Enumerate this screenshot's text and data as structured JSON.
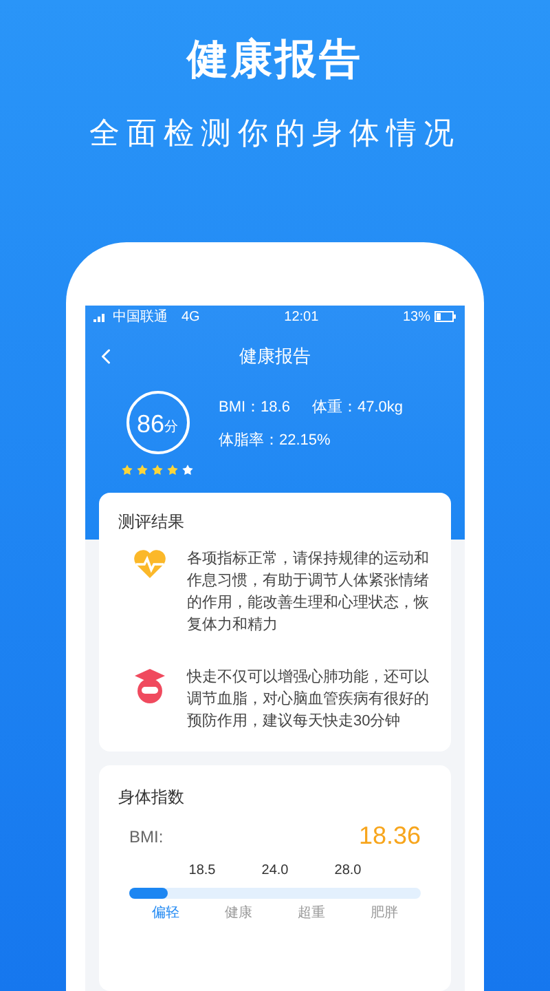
{
  "promo": {
    "title": "健康报告",
    "subtitle": "全面检测你的身体情况"
  },
  "status_bar": {
    "carrier": "中国联通",
    "network": "4G",
    "time": "12:01",
    "battery": "13%"
  },
  "nav": {
    "title": "健康报告"
  },
  "summary": {
    "score": "86",
    "unit": "分",
    "stars": 4,
    "bmi": "BMI：18.6",
    "weight": "体重：47.0kg",
    "body_fat": "体脂率：22.15%"
  },
  "results": {
    "title": "测评结果",
    "items": [
      {
        "kind": "heart",
        "text": "各项指标正常，请保持规律的运动和作息习惯，有助于调节人体紧张情绪的作用，能改善生理和心理状态，恢复体力和精力"
      },
      {
        "kind": "student",
        "text": "快走不仅可以增强心肺功能，还可以调节血脂，对心脑血管疾病有很好的预防作用，建议每天快走30分钟"
      }
    ]
  },
  "body_index": {
    "title": "身体指数",
    "label": "BMI:",
    "value": "18.36",
    "thresholds": [
      "18.5",
      "24.0",
      "28.0"
    ],
    "level": 0.13,
    "categories": [
      {
        "label": "偏轻",
        "selected": true
      },
      {
        "label": "健康",
        "selected": false
      },
      {
        "label": "超重",
        "selected": false
      },
      {
        "label": "肥胖",
        "selected": false
      }
    ]
  }
}
